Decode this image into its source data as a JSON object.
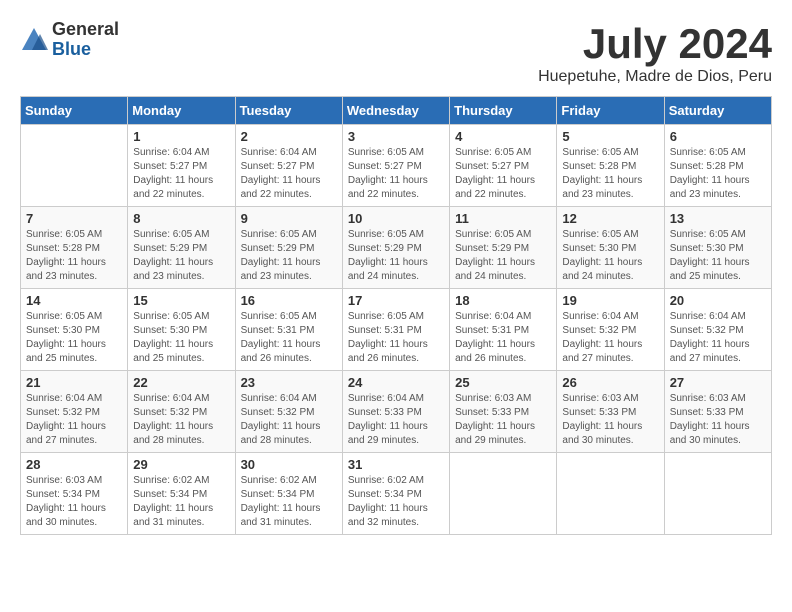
{
  "header": {
    "logo_general": "General",
    "logo_blue": "Blue",
    "title": "July 2024",
    "subtitle": "Huepetuhe, Madre de Dios, Peru"
  },
  "calendar": {
    "days_of_week": [
      "Sunday",
      "Monday",
      "Tuesday",
      "Wednesday",
      "Thursday",
      "Friday",
      "Saturday"
    ],
    "weeks": [
      [
        {
          "day": "",
          "info": ""
        },
        {
          "day": "1",
          "info": "Sunrise: 6:04 AM\nSunset: 5:27 PM\nDaylight: 11 hours\nand 22 minutes."
        },
        {
          "day": "2",
          "info": "Sunrise: 6:04 AM\nSunset: 5:27 PM\nDaylight: 11 hours\nand 22 minutes."
        },
        {
          "day": "3",
          "info": "Sunrise: 6:05 AM\nSunset: 5:27 PM\nDaylight: 11 hours\nand 22 minutes."
        },
        {
          "day": "4",
          "info": "Sunrise: 6:05 AM\nSunset: 5:27 PM\nDaylight: 11 hours\nand 22 minutes."
        },
        {
          "day": "5",
          "info": "Sunrise: 6:05 AM\nSunset: 5:28 PM\nDaylight: 11 hours\nand 23 minutes."
        },
        {
          "day": "6",
          "info": "Sunrise: 6:05 AM\nSunset: 5:28 PM\nDaylight: 11 hours\nand 23 minutes."
        }
      ],
      [
        {
          "day": "7",
          "info": "Sunrise: 6:05 AM\nSunset: 5:28 PM\nDaylight: 11 hours\nand 23 minutes."
        },
        {
          "day": "8",
          "info": "Sunrise: 6:05 AM\nSunset: 5:29 PM\nDaylight: 11 hours\nand 23 minutes."
        },
        {
          "day": "9",
          "info": "Sunrise: 6:05 AM\nSunset: 5:29 PM\nDaylight: 11 hours\nand 23 minutes."
        },
        {
          "day": "10",
          "info": "Sunrise: 6:05 AM\nSunset: 5:29 PM\nDaylight: 11 hours\nand 24 minutes."
        },
        {
          "day": "11",
          "info": "Sunrise: 6:05 AM\nSunset: 5:29 PM\nDaylight: 11 hours\nand 24 minutes."
        },
        {
          "day": "12",
          "info": "Sunrise: 6:05 AM\nSunset: 5:30 PM\nDaylight: 11 hours\nand 24 minutes."
        },
        {
          "day": "13",
          "info": "Sunrise: 6:05 AM\nSunset: 5:30 PM\nDaylight: 11 hours\nand 25 minutes."
        }
      ],
      [
        {
          "day": "14",
          "info": "Sunrise: 6:05 AM\nSunset: 5:30 PM\nDaylight: 11 hours\nand 25 minutes."
        },
        {
          "day": "15",
          "info": "Sunrise: 6:05 AM\nSunset: 5:30 PM\nDaylight: 11 hours\nand 25 minutes."
        },
        {
          "day": "16",
          "info": "Sunrise: 6:05 AM\nSunset: 5:31 PM\nDaylight: 11 hours\nand 26 minutes."
        },
        {
          "day": "17",
          "info": "Sunrise: 6:05 AM\nSunset: 5:31 PM\nDaylight: 11 hours\nand 26 minutes."
        },
        {
          "day": "18",
          "info": "Sunrise: 6:04 AM\nSunset: 5:31 PM\nDaylight: 11 hours\nand 26 minutes."
        },
        {
          "day": "19",
          "info": "Sunrise: 6:04 AM\nSunset: 5:32 PM\nDaylight: 11 hours\nand 27 minutes."
        },
        {
          "day": "20",
          "info": "Sunrise: 6:04 AM\nSunset: 5:32 PM\nDaylight: 11 hours\nand 27 minutes."
        }
      ],
      [
        {
          "day": "21",
          "info": "Sunrise: 6:04 AM\nSunset: 5:32 PM\nDaylight: 11 hours\nand 27 minutes."
        },
        {
          "day": "22",
          "info": "Sunrise: 6:04 AM\nSunset: 5:32 PM\nDaylight: 11 hours\nand 28 minutes."
        },
        {
          "day": "23",
          "info": "Sunrise: 6:04 AM\nSunset: 5:32 PM\nDaylight: 11 hours\nand 28 minutes."
        },
        {
          "day": "24",
          "info": "Sunrise: 6:04 AM\nSunset: 5:33 PM\nDaylight: 11 hours\nand 29 minutes."
        },
        {
          "day": "25",
          "info": "Sunrise: 6:03 AM\nSunset: 5:33 PM\nDaylight: 11 hours\nand 29 minutes."
        },
        {
          "day": "26",
          "info": "Sunrise: 6:03 AM\nSunset: 5:33 PM\nDaylight: 11 hours\nand 30 minutes."
        },
        {
          "day": "27",
          "info": "Sunrise: 6:03 AM\nSunset: 5:33 PM\nDaylight: 11 hours\nand 30 minutes."
        }
      ],
      [
        {
          "day": "28",
          "info": "Sunrise: 6:03 AM\nSunset: 5:34 PM\nDaylight: 11 hours\nand 30 minutes."
        },
        {
          "day": "29",
          "info": "Sunrise: 6:02 AM\nSunset: 5:34 PM\nDaylight: 11 hours\nand 31 minutes."
        },
        {
          "day": "30",
          "info": "Sunrise: 6:02 AM\nSunset: 5:34 PM\nDaylight: 11 hours\nand 31 minutes."
        },
        {
          "day": "31",
          "info": "Sunrise: 6:02 AM\nSunset: 5:34 PM\nDaylight: 11 hours\nand 32 minutes."
        },
        {
          "day": "",
          "info": ""
        },
        {
          "day": "",
          "info": ""
        },
        {
          "day": "",
          "info": ""
        }
      ]
    ]
  }
}
